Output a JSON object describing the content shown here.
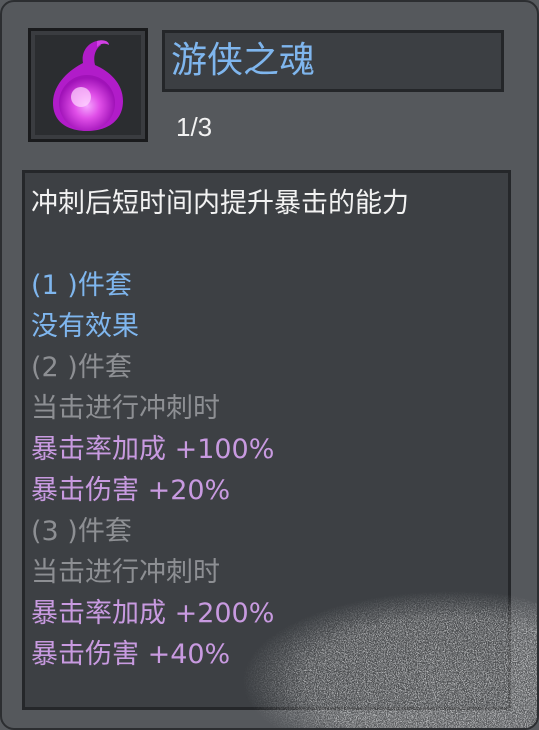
{
  "item": {
    "name": "游侠之魂",
    "count": "1/3",
    "icon": "magenta-soul-flame-icon"
  },
  "description": "冲刺后短时间内提升暴击的能力",
  "tiers": [
    {
      "header": "(1 )件套",
      "lines": [
        "没有效果"
      ]
    },
    {
      "header": "(2 )件套",
      "condition": "当击进行冲刺时",
      "lines": [
        "暴击率加成 +100%",
        "暴击伤害 +20%"
      ]
    },
    {
      "header": "(3 )件套",
      "condition": "当击进行冲刺时",
      "lines": [
        "暴击率加成 +200%",
        "暴击伤害 +40%"
      ]
    }
  ],
  "colors": {
    "title": "#7fb6ee",
    "active": "#7fb6ee",
    "inactive": "#8d8f93",
    "stat": "#c89ae0",
    "text": "#f2f2f2"
  }
}
